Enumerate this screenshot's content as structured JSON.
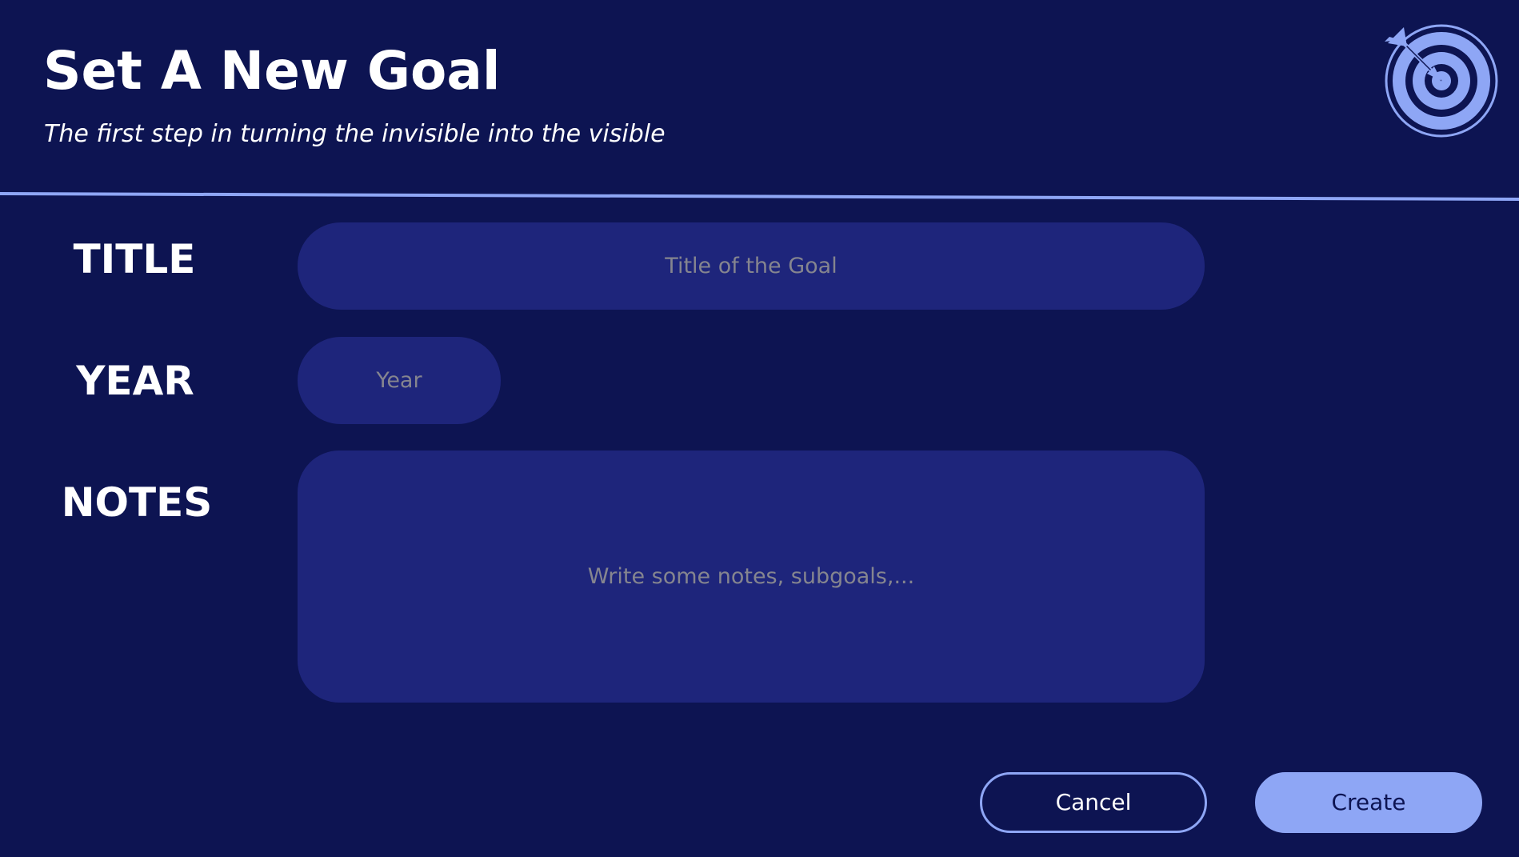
{
  "header": {
    "title": "Set A New Goal",
    "subtitle": "The first step in turning the invisible into the visible",
    "logo_icon": "target-arrow-icon"
  },
  "form": {
    "title_label": "TITLE",
    "title_placeholder": "Title of the Goal",
    "title_value": "",
    "year_label": "YEAR",
    "year_placeholder": "Year",
    "year_value": "",
    "notes_label": "NOTES",
    "notes_placeholder": "Write some notes, subgoals,...",
    "notes_value": ""
  },
  "actions": {
    "cancel_label": "Cancel",
    "create_label": "Create"
  },
  "colors": {
    "background": "#0d1452",
    "field_background": "#1e257b",
    "accent": "#8ea6f5",
    "text": "#ffffff",
    "placeholder": "#85858f"
  }
}
